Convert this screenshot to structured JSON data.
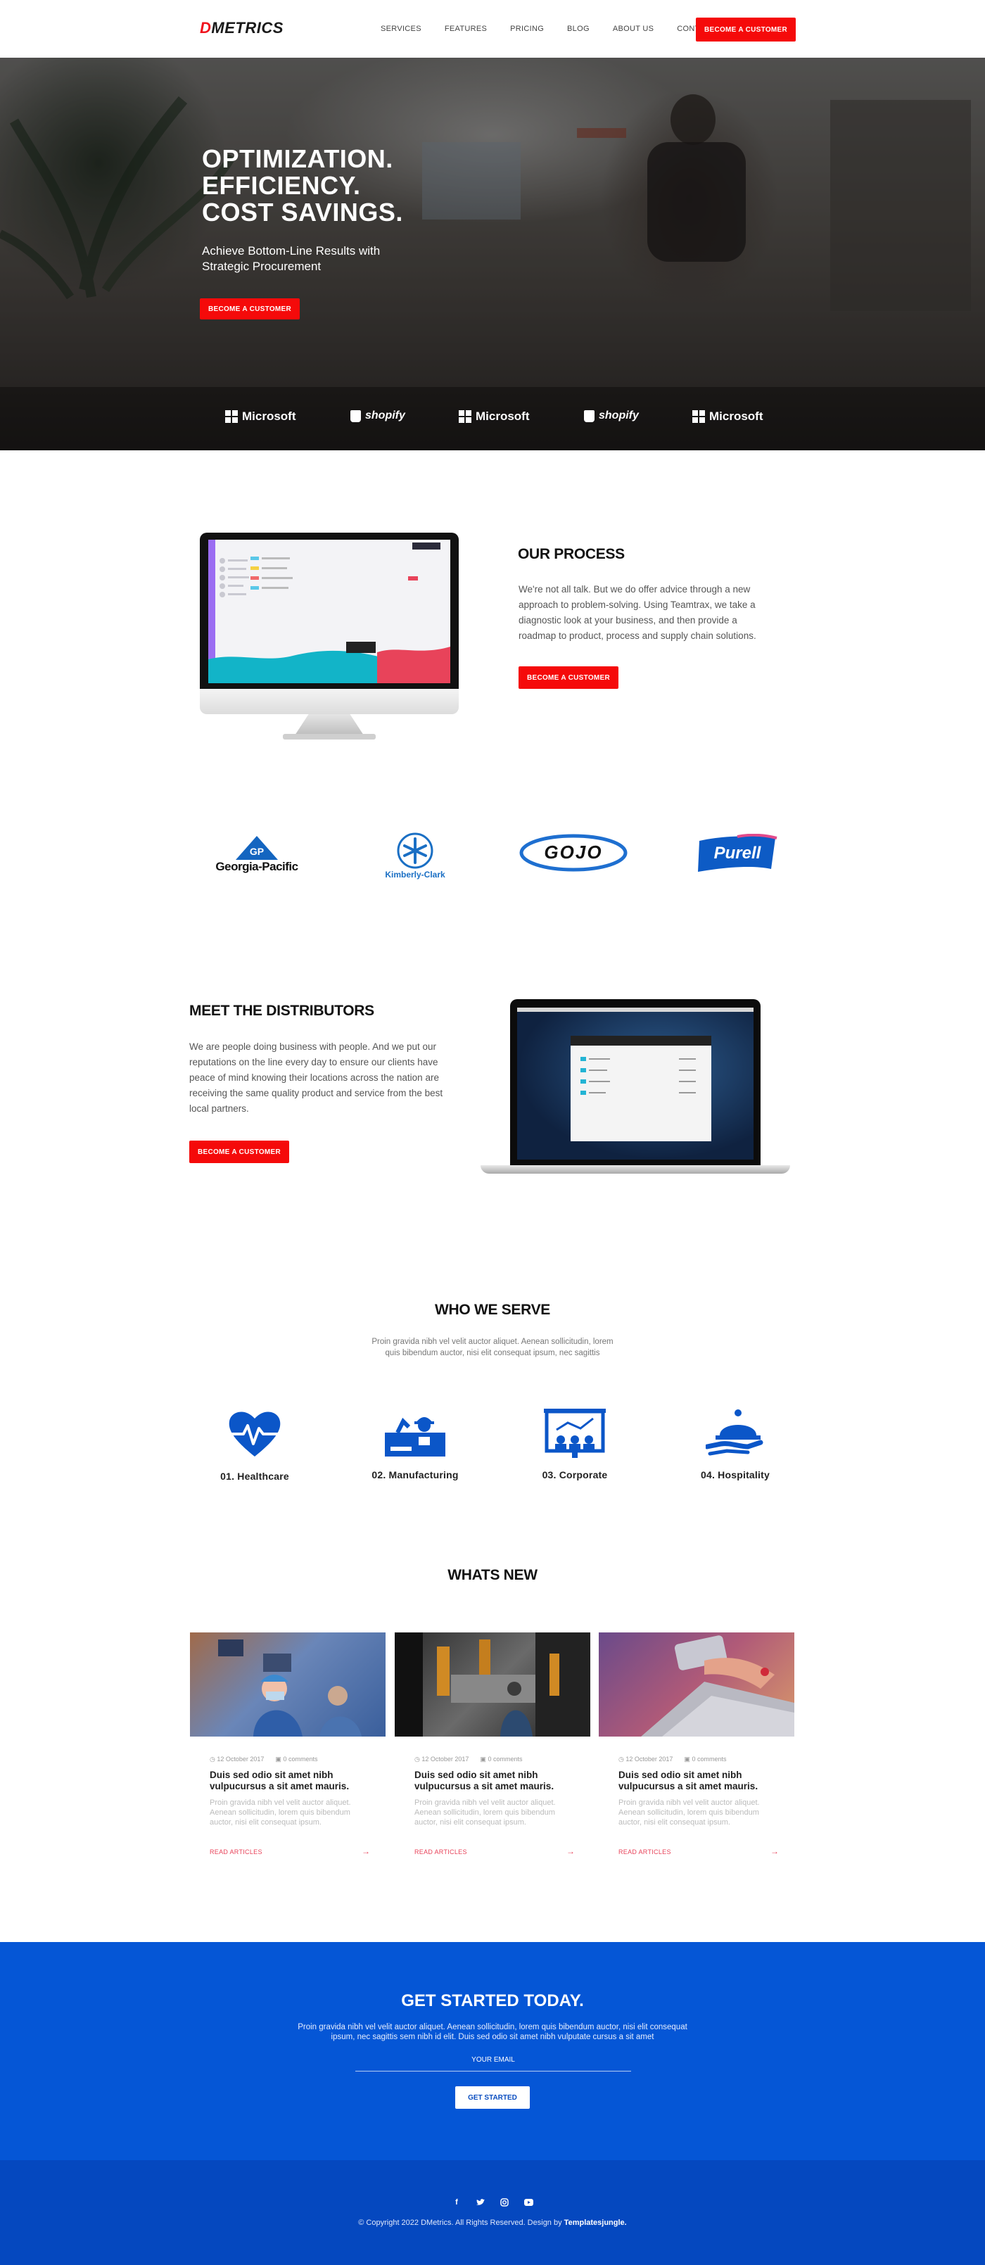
{
  "brand": {
    "logo_accent": "D",
    "logo_rest": "METRICS"
  },
  "nav": {
    "items": [
      "SERVICES",
      "FEATURES",
      "PRICING",
      "BLOG",
      "ABOUT US",
      "CONTACT"
    ],
    "cta": "BECOME A CUSTOMER"
  },
  "hero": {
    "headline": [
      "OPTIMIZATION.",
      "EFFICIENCY.",
      "COST SAVINGS."
    ],
    "subtitle": "Achieve Bottom-Line Results with Strategic Procurement",
    "cta": "BECOME A CUSTOMER",
    "partners": [
      "Microsoft",
      "shopify",
      "Microsoft",
      "shopify",
      "Microsoft"
    ]
  },
  "process": {
    "title": "OUR PROCESS",
    "body": "We're not all talk. But we do offer advice through a new approach to problem-solving. Using Teamtrax, we take a diagnostic look at your business, and then provide a roadmap to product, process and supply chain solutions.",
    "cta": "BECOME A CUSTOMER"
  },
  "brands": [
    "Georgia-Pacific",
    "Kimberly-Clark",
    "GOJO",
    "Purell"
  ],
  "distributors": {
    "title": "MEET THE DISTRIBUTORS",
    "body": "We are people doing business with people. And we put our reputations on the line every day to ensure our clients have peace of mind knowing their locations across the nation are receiving the same quality product and service from the best local partners.",
    "cta": "BECOME A CUSTOMER"
  },
  "serve": {
    "title": "WHO WE SERVE",
    "subtitle": "Proin gravida nibh vel velit auctor aliquet. Aenean sollicitudin, lorem quis bibendum auctor, nisi elit consequat ipsum, nec sagittis",
    "items": [
      {
        "label": "01. Healthcare",
        "icon": "heart-pulse-icon"
      },
      {
        "label": "02. Manufacturing",
        "icon": "factory-worker-icon"
      },
      {
        "label": "03. Corporate",
        "icon": "presentation-icon"
      },
      {
        "label": "04. Hospitality",
        "icon": "service-bell-icon"
      }
    ],
    "icon_color": "#0b56c8"
  },
  "news": {
    "title": "WHATS NEW",
    "cards": [
      {
        "date": "12 October 2017",
        "comments": "0 comments",
        "title": "Duis sed odio sit amet nibh vulpucursus a sit amet mauris.",
        "body": "Proin gravida nibh vel velit auctor aliquet. Aenean sollicitudin, lorem quis bibendum auctor, nisi elit consequat ipsum.",
        "link": "READ ARTICLES"
      },
      {
        "date": "12 October 2017",
        "comments": "0 comments",
        "title": "Duis sed odio sit amet nibh vulpucursus a sit amet mauris.",
        "body": "Proin gravida nibh vel velit auctor aliquet. Aenean sollicitudin, lorem quis bibendum auctor, nisi elit consequat ipsum.",
        "link": "READ ARTICLES"
      },
      {
        "date": "12 October 2017",
        "comments": "0 comments",
        "title": "Duis sed odio sit amet nibh vulpucursus a sit amet mauris.",
        "body": "Proin gravida nibh vel velit auctor aliquet. Aenean sollicitudin, lorem quis bibendum auctor, nisi elit consequat ipsum.",
        "link": "READ ARTICLES"
      }
    ]
  },
  "cta": {
    "title": "GET STARTED TODAY.",
    "body": "Proin gravida nibh vel velit auctor aliquet. Aenean sollicitudin, lorem quis bibendum auctor, nisi elit consequat ipsum, nec sagittis sem nibh id elit. Duis sed odio sit amet nibh vulputate cursus a sit amet",
    "email_placeholder": "YOUR EMAIL",
    "button": "GET STARTED"
  },
  "footer": {
    "copyright": "© Copyright 2022 DMetrics. All Rights Reserved. Design by",
    "credit": "Templatesjungle."
  },
  "colors": {
    "accent_red": "#f50a0a",
    "brand_blue": "#0556d6",
    "footer_blue": "#0548bf"
  }
}
